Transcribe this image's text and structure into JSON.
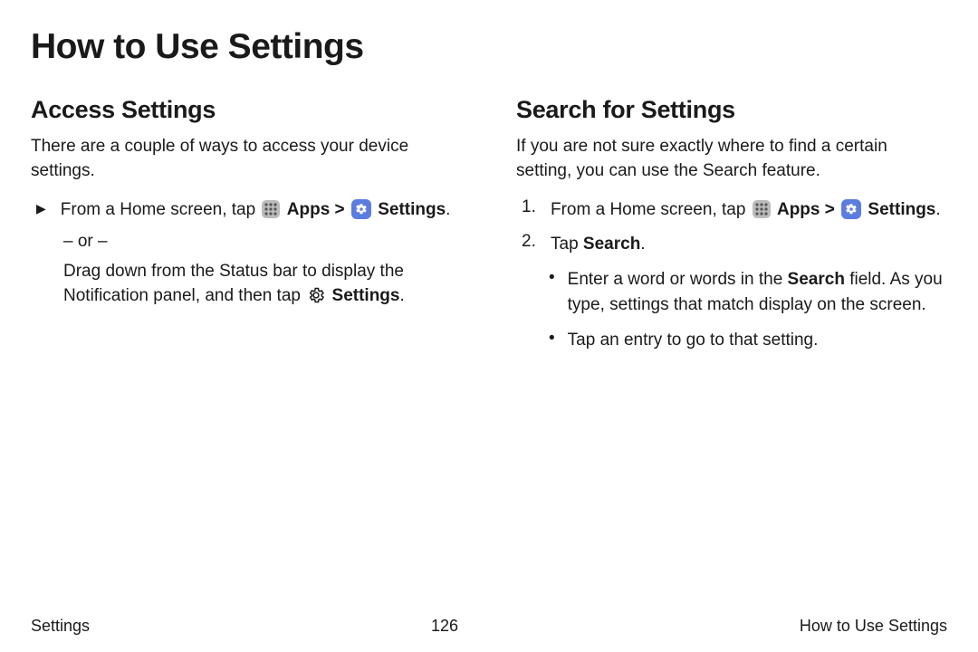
{
  "title": "How to Use Settings",
  "left": {
    "heading": "Access Settings",
    "intro": "There are a couple of ways to access your device settings.",
    "step_prefix": "From a Home screen, tap ",
    "apps_label": "Apps",
    "sep": " > ",
    "settings_label": "Settings",
    "period": ".",
    "or": "– or –",
    "drag_a": "Drag down from the Status bar to display the Notification panel, and then tap ",
    "drag_b": "Settings",
    "drag_c": "."
  },
  "right": {
    "heading": "Search for Settings",
    "intro": "If you are not sure exactly where to find a certain setting, you can use the Search feature.",
    "n1": "1.",
    "n2": "2.",
    "step1_prefix": "From a Home screen, tap ",
    "apps_label": "Apps",
    "sep": " > ",
    "settings_label": "Settings",
    "period": ".",
    "step2_a": "Tap ",
    "step2_b": "Search",
    "step2_c": ".",
    "b1a": "Enter a word or words in the ",
    "b1b": "Search",
    "b1c": " field. As you type, settings that match display on the screen.",
    "b2": "Tap an entry to go to that setting."
  },
  "footer": {
    "left": "Settings",
    "center": "126",
    "right": "How to Use Settings"
  }
}
